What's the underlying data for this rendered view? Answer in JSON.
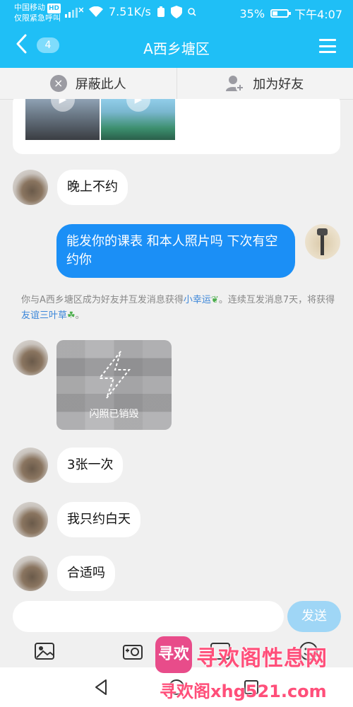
{
  "status_bar": {
    "carrier": "中国移动",
    "network_badge": "HD",
    "emergency": "仅限紧急呼叫",
    "speed": "7.51K/s",
    "battery_percent": "35%",
    "time": "下午4:07",
    "battery_level": 0.35
  },
  "header": {
    "back_icon": "chevron-left-icon",
    "unread_count": "4",
    "title": "A西乡塘区",
    "menu_icon": "hamburger-menu-icon"
  },
  "actions": {
    "block_label": "屏蔽此人",
    "add_friend_label": "加为好友"
  },
  "messages": [
    {
      "from": "other",
      "text": "晚上不约"
    },
    {
      "from": "self",
      "text": "能发你的课表 和本人照片吗 下次有空约你"
    },
    {
      "from": "other",
      "text": "3张一次"
    },
    {
      "from": "other",
      "text": "我只约白天"
    },
    {
      "from": "other",
      "text": "合适吗"
    }
  ],
  "system_message": {
    "part1": "你与A西乡塘区成为好友并互发消息获得",
    "link1": "小幸运",
    "part2": "。连续互发消息7天，将获得",
    "link2": "友谊三叶草",
    "part3": "。"
  },
  "flash_photo": {
    "label": "闪照已销毁"
  },
  "composer": {
    "input_value": "",
    "send_label": "发送"
  },
  "watermark": {
    "logo_text": "寻欢",
    "line1": "寻欢阁性息网",
    "line2": "寻欢阁xhg521.com"
  },
  "colors": {
    "header": "#1fbff6",
    "self_bubble": "#1b8ff6",
    "send_button": "#9fd6f6",
    "link": "#3b86d9"
  }
}
